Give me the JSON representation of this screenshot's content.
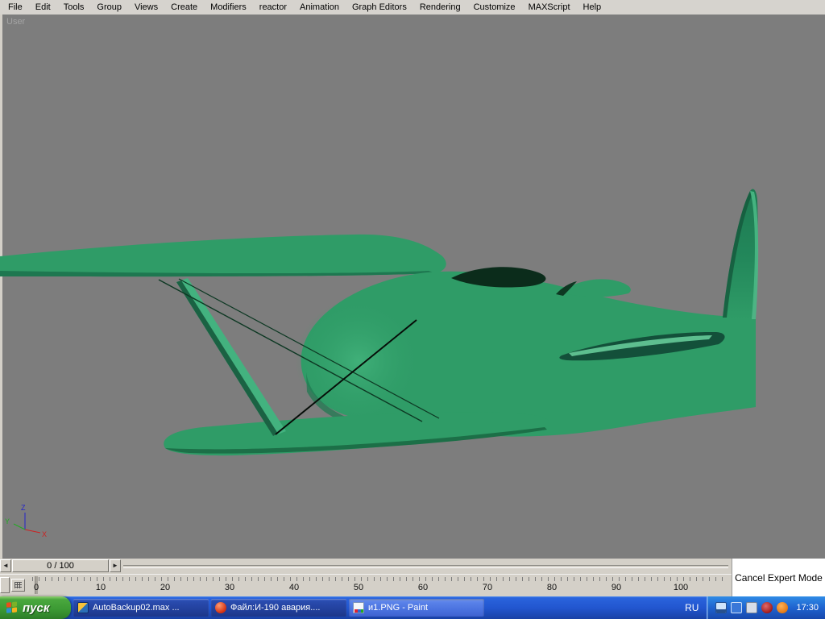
{
  "menu": {
    "items": [
      "File",
      "Edit",
      "Tools",
      "Group",
      "Views",
      "Create",
      "Modifiers",
      "reactor",
      "Animation",
      "Graph Editors",
      "Rendering",
      "Customize",
      "MAXScript",
      "Help"
    ]
  },
  "viewport": {
    "label": "User",
    "axis_labels": {
      "x": "X",
      "y": "Y",
      "z": "Z"
    }
  },
  "timeline": {
    "frame_display": "0 / 100",
    "prev_arrow": "◄",
    "next_arrow": "►",
    "ticks": [
      "0",
      "10",
      "20",
      "30",
      "40",
      "50",
      "60",
      "70",
      "80",
      "90",
      "100"
    ]
  },
  "expert_mode": {
    "cancel_label": "Cancel Expert Mode"
  },
  "taskbar": {
    "start_label": "пуск",
    "tasks": [
      {
        "label": "AutoBackup02.max ...",
        "icon": "3dsmax-file-icon"
      },
      {
        "label": "Файл:И-190 авария....",
        "icon": "browser-icon"
      },
      {
        "label": "и1.PNG - Paint",
        "icon": "paint-icon"
      }
    ],
    "language": "RU",
    "clock": "17:30",
    "tray_icons": [
      "display-icon",
      "network-icon",
      "antivirus-icon",
      "messenger-icon",
      "volume-icon"
    ]
  },
  "colors": {
    "viewport_bg": "#7d7d7d",
    "model_green": "#2f9c67",
    "model_shadow": "#14523a",
    "ui_gray": "#d4d0c8",
    "taskbar_blue": "#2256cf",
    "start_green": "#3c9a34"
  }
}
